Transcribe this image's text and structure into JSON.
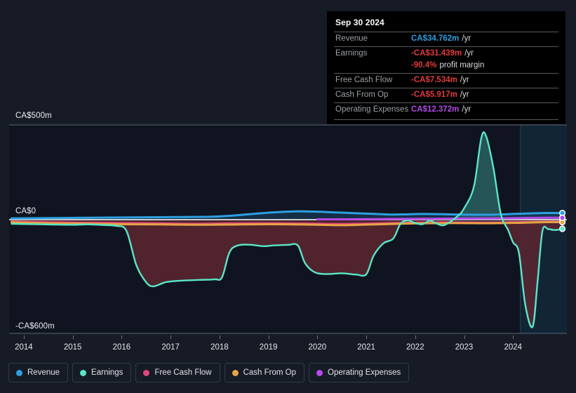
{
  "chart_data": {
    "type": "area",
    "title": "",
    "currency": "CA$",
    "xlabel": "",
    "ylabel": "",
    "ylim": [
      -600,
      500
    ],
    "y_ticks": [
      {
        "value": 500,
        "label": "CA$500m"
      },
      {
        "value": 0,
        "label": "CA$0"
      },
      {
        "value": -600,
        "label": "-CA$600m"
      }
    ],
    "x_ticks": [
      "2014",
      "2015",
      "2016",
      "2017",
      "2018",
      "2019",
      "2020",
      "2021",
      "2022",
      "2023",
      "2024"
    ],
    "grid": false,
    "legend_position": "bottom",
    "x_start": 2013.7,
    "x_end": 2025.1,
    "forecast_start": 2024.15,
    "series": [
      {
        "name": "Revenue",
        "color": "#2d9fe0",
        "points": [
          [
            2013.75,
            7
          ],
          [
            2014.25,
            8
          ],
          [
            2014.75,
            9
          ],
          [
            2015.25,
            10
          ],
          [
            2015.75,
            11
          ],
          [
            2016.25,
            12
          ],
          [
            2016.75,
            13
          ],
          [
            2017.25,
            14
          ],
          [
            2017.75,
            15
          ],
          [
            2018.0,
            17
          ],
          [
            2018.4,
            24
          ],
          [
            2018.8,
            33
          ],
          [
            2019.2,
            40
          ],
          [
            2019.6,
            44
          ],
          [
            2020.0,
            42
          ],
          [
            2020.4,
            38
          ],
          [
            2020.8,
            34
          ],
          [
            2021.2,
            30
          ],
          [
            2021.5,
            27
          ],
          [
            2021.8,
            28
          ],
          [
            2022.1,
            30
          ],
          [
            2022.5,
            29
          ],
          [
            2022.9,
            27
          ],
          [
            2023.3,
            26
          ],
          [
            2023.7,
            27
          ],
          [
            2024.0,
            30
          ],
          [
            2024.35,
            33
          ],
          [
            2024.7,
            35
          ],
          [
            2025.05,
            35
          ]
        ]
      },
      {
        "name": "Earnings",
        "color": "#5ae6c8",
        "points": [
          [
            2013.75,
            -22
          ],
          [
            2014.2,
            -24
          ],
          [
            2014.6,
            -26
          ],
          [
            2015.0,
            -27
          ],
          [
            2015.3,
            -25
          ],
          [
            2015.6,
            -28
          ],
          [
            2015.9,
            -33
          ],
          [
            2016.1,
            -60
          ],
          [
            2016.3,
            -240
          ],
          [
            2016.5,
            -330
          ],
          [
            2016.65,
            -352
          ],
          [
            2016.9,
            -330
          ],
          [
            2017.2,
            -322
          ],
          [
            2017.6,
            -318
          ],
          [
            2017.9,
            -315
          ],
          [
            2018.05,
            -305
          ],
          [
            2018.2,
            -175
          ],
          [
            2018.35,
            -138
          ],
          [
            2018.6,
            -132
          ],
          [
            2018.9,
            -140
          ],
          [
            2019.1,
            -136
          ],
          [
            2019.4,
            -133
          ],
          [
            2019.6,
            -136
          ],
          [
            2019.75,
            -230
          ],
          [
            2019.95,
            -278
          ],
          [
            2020.2,
            -287
          ],
          [
            2020.5,
            -283
          ],
          [
            2020.8,
            -290
          ],
          [
            2021.0,
            -288
          ],
          [
            2021.15,
            -190
          ],
          [
            2021.35,
            -125
          ],
          [
            2021.55,
            -100
          ],
          [
            2021.7,
            -22
          ],
          [
            2021.85,
            -5
          ],
          [
            2022.0,
            -18
          ],
          [
            2022.15,
            -24
          ],
          [
            2022.3,
            -5
          ],
          [
            2022.45,
            -22
          ],
          [
            2022.6,
            -28
          ],
          [
            2022.85,
            15
          ],
          [
            2023.0,
            60
          ],
          [
            2023.2,
            175
          ],
          [
            2023.35,
            430
          ],
          [
            2023.45,
            440
          ],
          [
            2023.6,
            270
          ],
          [
            2023.75,
            30
          ],
          [
            2023.9,
            -55
          ],
          [
            2024.0,
            -120
          ],
          [
            2024.12,
            -175
          ],
          [
            2024.25,
            -450
          ],
          [
            2024.4,
            -565
          ],
          [
            2024.5,
            -330
          ],
          [
            2024.6,
            -60
          ],
          [
            2024.72,
            -50
          ],
          [
            2024.85,
            -55
          ],
          [
            2025.05,
            -48
          ]
        ]
      },
      {
        "name": "Free Cash Flow",
        "color": "#e0467c",
        "points": [
          [
            2013.75,
            -10
          ],
          [
            2014.5,
            -14
          ],
          [
            2015.2,
            -16
          ],
          [
            2016.0,
            -18
          ],
          [
            2016.8,
            -20
          ],
          [
            2017.5,
            -22
          ],
          [
            2018.2,
            -20
          ],
          [
            2019.0,
            -19
          ],
          [
            2019.8,
            -21
          ],
          [
            2020.5,
            -23
          ],
          [
            2021.2,
            -20
          ],
          [
            2022.0,
            -16
          ],
          [
            2022.8,
            -14
          ],
          [
            2023.5,
            -15
          ],
          [
            2024.2,
            -13
          ],
          [
            2024.7,
            -11
          ],
          [
            2025.05,
            -11
          ]
        ]
      },
      {
        "name": "Cash From Op",
        "color": "#e8a345",
        "points": [
          [
            2013.75,
            -14
          ],
          [
            2014.5,
            -19
          ],
          [
            2015.2,
            -21
          ],
          [
            2016.0,
            -24
          ],
          [
            2016.8,
            -25
          ],
          [
            2017.5,
            -27
          ],
          [
            2018.2,
            -26
          ],
          [
            2019.0,
            -24
          ],
          [
            2019.8,
            -26
          ],
          [
            2020.5,
            -29
          ],
          [
            2021.2,
            -25
          ],
          [
            2022.0,
            -20
          ],
          [
            2022.8,
            -18
          ],
          [
            2023.5,
            -19
          ],
          [
            2024.2,
            -16
          ],
          [
            2024.7,
            -13
          ],
          [
            2025.05,
            -13
          ]
        ]
      },
      {
        "name": "Operating Expenses",
        "color": "#b44ae8",
        "points": [
          [
            2020.0,
            2
          ],
          [
            2020.6,
            2
          ],
          [
            2021.2,
            3
          ],
          [
            2021.8,
            4
          ],
          [
            2022.4,
            5
          ],
          [
            2023.0,
            6
          ],
          [
            2023.6,
            7
          ],
          [
            2024.2,
            9
          ],
          [
            2024.7,
            10
          ],
          [
            2025.05,
            10
          ]
        ]
      }
    ]
  },
  "tooltip": {
    "date": "Sep 30 2024",
    "rows": [
      {
        "key": "Revenue",
        "value": "CA$34.762m",
        "suffix": "/yr",
        "color": "#2d9fe0"
      },
      {
        "key": "Earnings",
        "value": "-CA$31.439m",
        "suffix": "/yr",
        "color": "#e23b3b"
      },
      {
        "key": "",
        "value": "-90.4%",
        "suffix": "profit margin",
        "color": "#e23b3b"
      },
      {
        "key": "Free Cash Flow",
        "value": "-CA$7.534m",
        "suffix": "/yr",
        "color": "#e23b3b"
      },
      {
        "key": "Cash From Op",
        "value": "-CA$5.917m",
        "suffix": "/yr",
        "color": "#e23b3b"
      },
      {
        "key": "Operating Expenses",
        "value": "CA$12.372m",
        "suffix": "/yr",
        "color": "#b44ae8"
      }
    ]
  },
  "legend": {
    "items": [
      {
        "label": "Revenue",
        "color": "#2d9fe0"
      },
      {
        "label": "Earnings",
        "color": "#5ae6c8"
      },
      {
        "label": "Free Cash Flow",
        "color": "#e0467c"
      },
      {
        "label": "Cash From Op",
        "color": "#e8a345"
      },
      {
        "label": "Operating Expenses",
        "color": "#b44ae8"
      }
    ]
  },
  "colors": {
    "background": "#161b26",
    "plot_background": "#0f1420",
    "forecast_shade": "#13283a",
    "zero_line": "#c9ccd1",
    "axis_line": "#5b6472",
    "positive_fill": "#2d6b68",
    "negative_fill": "#5c2630"
  }
}
